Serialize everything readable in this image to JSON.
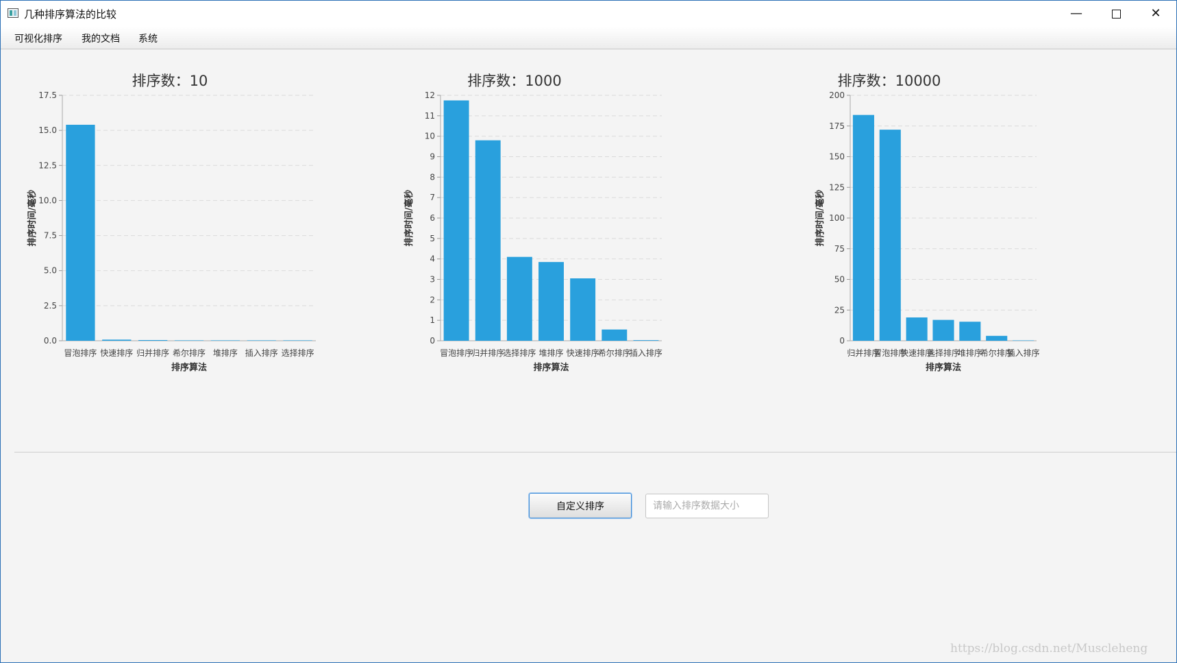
{
  "window": {
    "title": "几种排序算法的比较",
    "minimize_glyph": "—",
    "close_glyph": "✕"
  },
  "menu": {
    "items": [
      "可视化排序",
      "我的文档",
      "系统"
    ]
  },
  "chart_data": [
    {
      "type": "bar",
      "title": "排序数：10",
      "xlabel": "排序算法",
      "ylabel": "排序时间/毫秒",
      "categories": [
        "冒泡排序",
        "快速排序",
        "归并排序",
        "希尔排序",
        "堆排序",
        "插入排序",
        "选择排序"
      ],
      "values": [
        15.4,
        0.08,
        0.05,
        0.03,
        0.03,
        0.03,
        0.03
      ],
      "ylim": [
        0,
        17.5
      ],
      "yticks": [
        "0.0",
        "2.5",
        "5.0",
        "7.5",
        "10.0",
        "12.5",
        "15.0",
        "17.5"
      ],
      "ytick_values": [
        0,
        2.5,
        5,
        7.5,
        10,
        12.5,
        15,
        17.5
      ],
      "grid": true,
      "color": "#29a0dd"
    },
    {
      "type": "bar",
      "title": "排序数：1000",
      "xlabel": "排序算法",
      "ylabel": "排序时间/毫秒",
      "categories": [
        "冒泡排序",
        "归并排序",
        "选择排序",
        "堆排序",
        "快速排序",
        "希尔排序",
        "插入排序"
      ],
      "values": [
        11.75,
        9.8,
        4.1,
        3.85,
        3.05,
        0.55,
        0.03
      ],
      "ylim": [
        0,
        12
      ],
      "yticks": [
        "0",
        "1",
        "2",
        "3",
        "4",
        "5",
        "6",
        "7",
        "8",
        "9",
        "10",
        "11",
        "12"
      ],
      "ytick_values": [
        0,
        1,
        2,
        3,
        4,
        5,
        6,
        7,
        8,
        9,
        10,
        11,
        12
      ],
      "grid": true,
      "color": "#29a0dd"
    },
    {
      "type": "bar",
      "title": "排序数：10000",
      "xlabel": "排序算法",
      "ylabel": "排序时间/毫秒",
      "categories": [
        "归并排序",
        "冒泡排序",
        "快速排序",
        "选择排序",
        "堆排序",
        "希尔排序",
        "插入排序"
      ],
      "values": [
        184,
        172,
        19,
        17,
        15.5,
        4,
        0.3
      ],
      "ylim": [
        0,
        200
      ],
      "yticks": [
        "0",
        "25",
        "50",
        "75",
        "100",
        "125",
        "150",
        "175",
        "200"
      ],
      "ytick_values": [
        0,
        25,
        50,
        75,
        100,
        125,
        150,
        175,
        200
      ],
      "grid": true,
      "color": "#29a0dd"
    }
  ],
  "controls": {
    "custom_sort_label": "自定义排序",
    "size_input_placeholder": "请输入排序数据大小",
    "size_input_value": ""
  },
  "watermark": "https://blog.csdn.net/Muscleheng",
  "colors": {
    "bar": "#29a0dd",
    "button_focus": "#3a8ad8"
  }
}
